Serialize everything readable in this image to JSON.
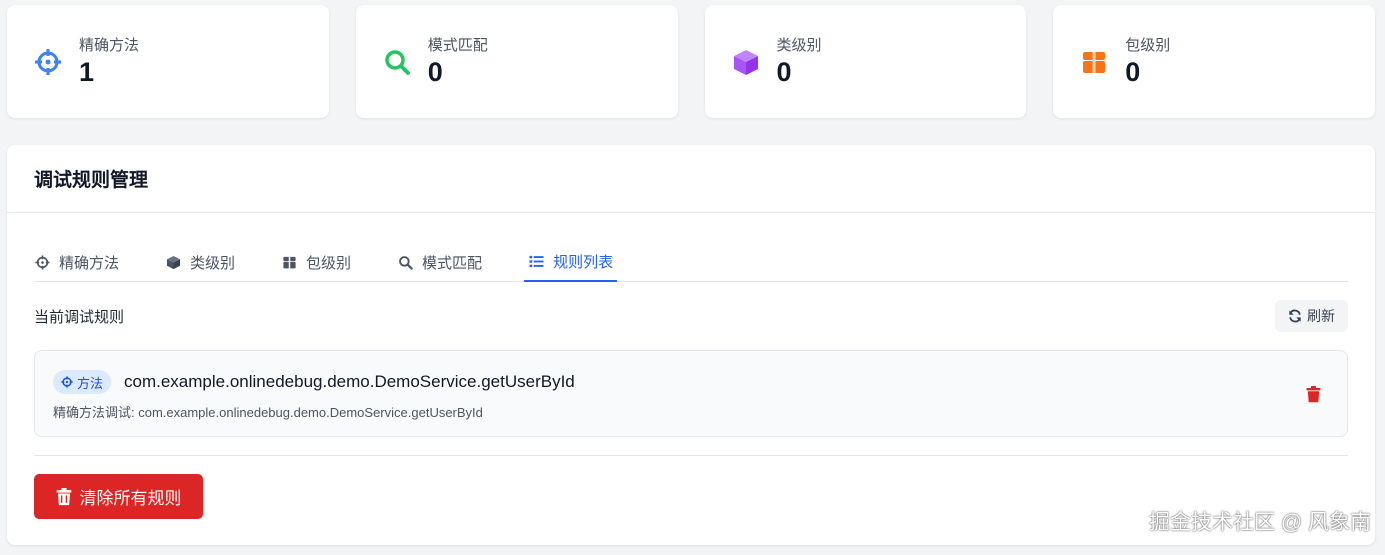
{
  "stats": [
    {
      "label": "精确方法",
      "value": "1",
      "icon": "crosshairs-icon",
      "color": "#3b82f6"
    },
    {
      "label": "模式匹配",
      "value": "0",
      "icon": "search-icon",
      "color": "#22c55e"
    },
    {
      "label": "类级别",
      "value": "0",
      "icon": "cube-icon",
      "color": "#a855f7"
    },
    {
      "label": "包级别",
      "value": "0",
      "icon": "box-icon",
      "color": "#f97316"
    }
  ],
  "panel": {
    "title": "调试规则管理",
    "tabs": [
      {
        "label": "精确方法",
        "icon": "crosshairs-icon"
      },
      {
        "label": "类级别",
        "icon": "cube-icon"
      },
      {
        "label": "包级别",
        "icon": "box-icon"
      },
      {
        "label": "模式匹配",
        "icon": "search-icon"
      },
      {
        "label": "规则列表",
        "icon": "list-icon",
        "active": true
      }
    ],
    "current_label": "当前调试规则",
    "refresh_label": "刷新",
    "rules": [
      {
        "badge": "方法",
        "name": "com.example.onlinedebug.demo.DemoService.getUserById",
        "description": "精确方法调试: com.example.onlinedebug.demo.DemoService.getUserById"
      }
    ],
    "clear_all_label": "清除所有规则"
  },
  "watermark": "掘金技术社区 @ 风象南",
  "colors": {
    "accent": "#2563eb",
    "danger": "#dc2626",
    "badge_bg": "#dbeafe"
  }
}
